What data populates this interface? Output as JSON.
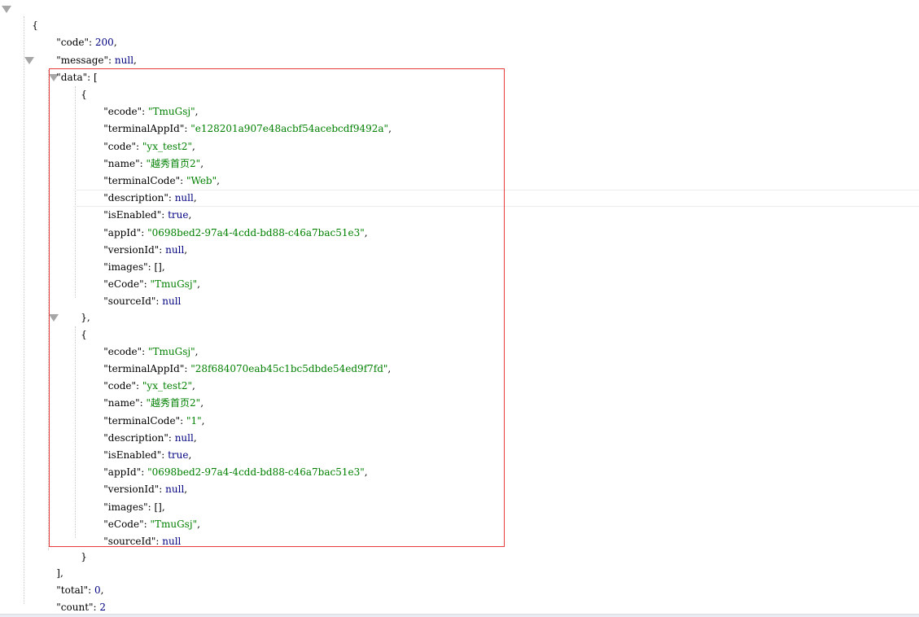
{
  "brackets": {
    "open_brace": "{",
    "close_brace": "}",
    "open_bracket": "[",
    "close_bracket_comma": "],",
    "close_brace_comma": "},"
  },
  "colors": {
    "key": "#000000",
    "string": "#008000",
    "literal": "#000080",
    "highlight_box": "#e8393b",
    "toggle": "#a6a6a6"
  },
  "icons": {
    "toggle": "collapse-triangle-icon"
  },
  "root": {
    "code": {
      "key": "\"code\"",
      "sep": ": ",
      "value": "200",
      "suffix": ","
    },
    "message": {
      "key": "\"message\"",
      "sep": ": ",
      "value": "null",
      "suffix": ","
    },
    "data": {
      "key": "\"data\"",
      "sep": ": "
    },
    "total": {
      "key": "\"total\"",
      "sep": ": ",
      "value": "0",
      "suffix": ","
    },
    "count": {
      "key": "\"count\"",
      "sep": ": ",
      "value": "2",
      "suffix": ""
    }
  },
  "items": [
    {
      "ecode": {
        "key": "\"ecode\"",
        "value": "\"TmuGsj\""
      },
      "terminalAppId": {
        "key": "\"terminalAppId\"",
        "value": "\"e128201a907e48acbf54acebcdf9492a\""
      },
      "code": {
        "key": "\"code\"",
        "value": "\"yx_test2\""
      },
      "name": {
        "key": "\"name\"",
        "value": "\"越秀首页2\""
      },
      "terminalCode": {
        "key": "\"terminalCode\"",
        "value": "\"Web\""
      },
      "description": {
        "key": "\"description\"",
        "value": "null"
      },
      "isEnabled": {
        "key": "\"isEnabled\"",
        "value": "true"
      },
      "appId": {
        "key": "\"appId\"",
        "value": "\"0698bed2-97a4-4cdd-bd88-c46a7bac51e3\""
      },
      "versionId": {
        "key": "\"versionId\"",
        "value": "null"
      },
      "images": {
        "key": "\"images\"",
        "value": "[]"
      },
      "eCode": {
        "key": "\"eCode\"",
        "value": "\"TmuGsj\""
      },
      "sourceId": {
        "key": "\"sourceId\"",
        "value": "null"
      }
    },
    {
      "ecode": {
        "key": "\"ecode\"",
        "value": "\"TmuGsj\""
      },
      "terminalAppId": {
        "key": "\"terminalAppId\"",
        "value": "\"28f684070eab45c1bc5dbde54ed9f7fd\""
      },
      "code": {
        "key": "\"code\"",
        "value": "\"yx_test2\""
      },
      "name": {
        "key": "\"name\"",
        "value": "\"越秀首页2\""
      },
      "terminalCode": {
        "key": "\"terminalCode\"",
        "value": "\"1\""
      },
      "description": {
        "key": "\"description\"",
        "value": "null"
      },
      "isEnabled": {
        "key": "\"isEnabled\"",
        "value": "true"
      },
      "appId": {
        "key": "\"appId\"",
        "value": "\"0698bed2-97a4-4cdd-bd88-c46a7bac51e3\""
      },
      "versionId": {
        "key": "\"versionId\"",
        "value": "null"
      },
      "images": {
        "key": "\"images\"",
        "value": "[]"
      },
      "eCode": {
        "key": "\"eCode\"",
        "value": "\"TmuGsj\""
      },
      "sourceId": {
        "key": "\"sourceId\"",
        "value": "null"
      }
    }
  ],
  "punct": {
    "colon": ": ",
    "comma": ","
  }
}
